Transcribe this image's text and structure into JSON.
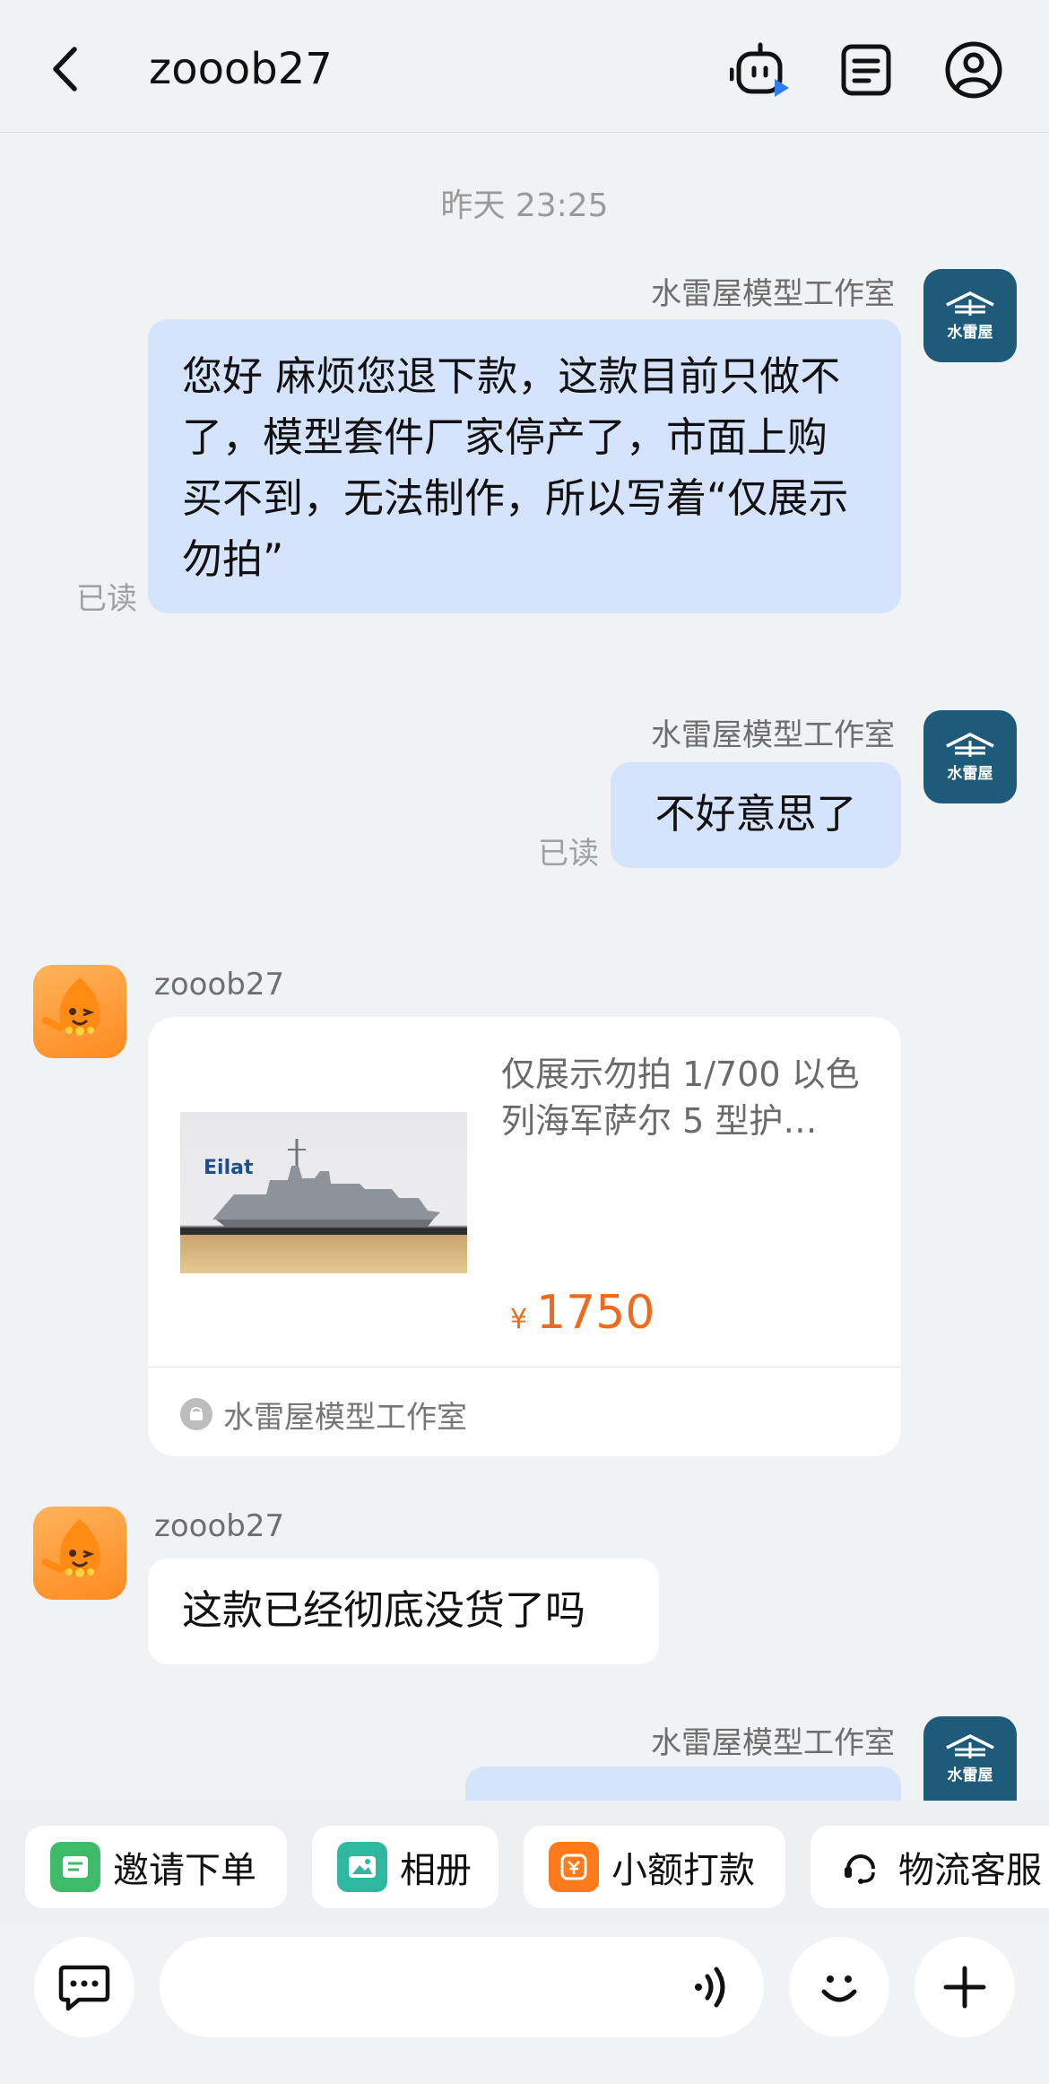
{
  "header": {
    "title": "zooob27"
  },
  "timestamp": "昨天 23:25",
  "messages": [
    {
      "sender": "水雷屋模型工作室",
      "text": "您好 麻烦您退下款，这款目前只做不了，模型套件厂家停产了，市面上购买不到，无法制作，所以写着“仅展示勿拍”",
      "status": "已读"
    },
    {
      "sender": "水雷屋模型工作室",
      "text": "不好意思了",
      "status": "已读"
    },
    {
      "sender": "zooob27"
    },
    {
      "sender": "zooob27",
      "text": "这款已经彻底没货了吗"
    },
    {
      "sender": "水雷屋模型工作室"
    }
  ],
  "shop_avatar_text": "水雷屋",
  "product_card": {
    "title": "仅展示勿拍 1/700 以色列海军萨尔 5 型护…",
    "currency": "¥",
    "price": "1750",
    "shop": "水雷屋模型工作室",
    "image_label": "Eilat"
  },
  "quick_actions": [
    {
      "label": "邀请下单",
      "icon": "invite-order-icon",
      "color": "#3dbb6a"
    },
    {
      "label": "相册",
      "icon": "album-icon",
      "color": "#2fb7a0"
    },
    {
      "label": "小额打款",
      "icon": "small-payment-icon",
      "color": "#ff7a1a"
    },
    {
      "label": "物流客服",
      "icon": "logistics-service-icon",
      "color": "#111111"
    }
  ],
  "input": {
    "placeholder": ""
  },
  "colors": {
    "outgoing_bubble": "#d6e3fc",
    "price": "#f06a1d",
    "shop_avatar": "#1e5a7a"
  }
}
